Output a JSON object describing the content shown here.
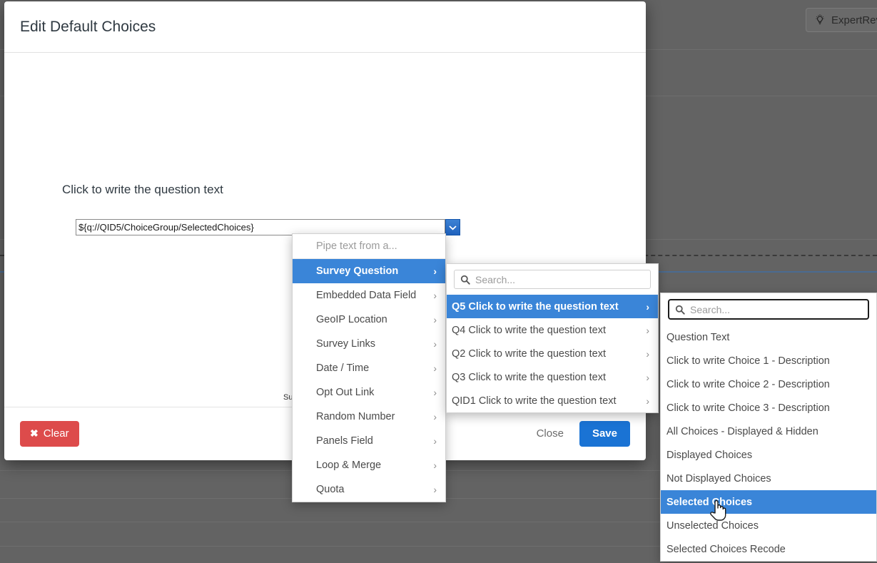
{
  "backdrop": {
    "expertrev": {
      "label": "ExpertRev",
      "icon": "lightbulb-icon"
    }
  },
  "modal": {
    "title": "Edit Default Choices",
    "question_text": "Click to write the question text",
    "survey_stub": "Sur",
    "pipe_input": {
      "value": "${q://QID5/ChoiceGroup/SelectedChoices}",
      "placeholder": ""
    },
    "footer": {
      "clear_label": "Clear",
      "clear_icon": "x-mark-icon",
      "close_label": "Close",
      "save_label": "Save"
    }
  },
  "menu_pipe": {
    "heading": "Pipe text from a...",
    "items": [
      {
        "label": "Survey Question",
        "selected": true
      },
      {
        "label": "Embedded Data Field",
        "selected": false
      },
      {
        "label": "GeoIP Location",
        "selected": false
      },
      {
        "label": "Survey Links",
        "selected": false
      },
      {
        "label": "Date / Time",
        "selected": false
      },
      {
        "label": "Opt Out Link",
        "selected": false
      },
      {
        "label": "Random Number",
        "selected": false
      },
      {
        "label": "Panels Field",
        "selected": false
      },
      {
        "label": "Loop & Merge",
        "selected": false
      },
      {
        "label": "Quota",
        "selected": false
      }
    ]
  },
  "menu_questions": {
    "search_placeholder": "Search...",
    "items": [
      {
        "label": "Q5 Click to write the question text",
        "selected": true
      },
      {
        "label": "Q4 Click to write the question text",
        "selected": false
      },
      {
        "label": "Q2 Click to write the question text",
        "selected": false
      },
      {
        "label": "Q3 Click to write the question text",
        "selected": false
      },
      {
        "label": "QID1 Click to write the question text",
        "selected": false
      }
    ]
  },
  "menu_fields": {
    "search_placeholder": "Search...",
    "items": [
      {
        "label": "Question Text",
        "selected": false
      },
      {
        "label": "Click to write Choice 1 - Description",
        "selected": false
      },
      {
        "label": "Click to write Choice 2 - Description",
        "selected": false
      },
      {
        "label": "Click to write Choice 3 - Description",
        "selected": false
      },
      {
        "label": "All Choices - Displayed & Hidden",
        "selected": false
      },
      {
        "label": "Displayed Choices",
        "selected": false
      },
      {
        "label": "Not Displayed Choices",
        "selected": false
      },
      {
        "label": "Selected Choices",
        "selected": true
      },
      {
        "label": "Unselected Choices",
        "selected": false
      },
      {
        "label": "Selected Choices Recode",
        "selected": false
      }
    ]
  },
  "colors": {
    "accent_blue": "#3a85d8",
    "save_blue": "#1a73d4",
    "clear_red": "#dd4b4b",
    "backdrop": "#636363"
  }
}
